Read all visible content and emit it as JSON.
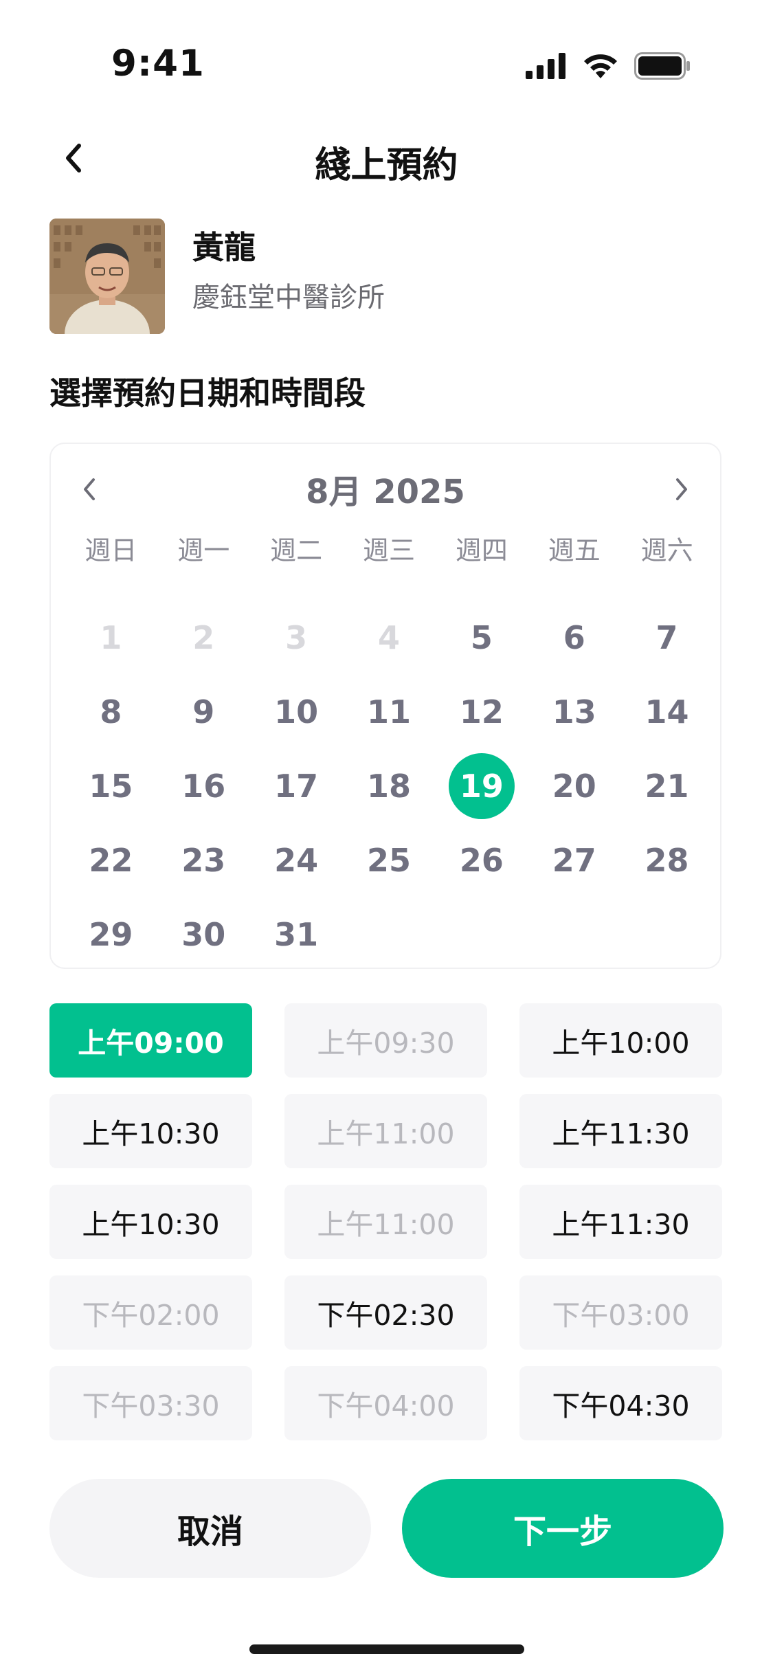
{
  "status_bar": {
    "time": "9:41"
  },
  "header": {
    "title": "綫上預約",
    "back_icon": "chevron-left-icon"
  },
  "doctor": {
    "name": "黃龍",
    "clinic": "慶鈺堂中醫診所"
  },
  "section_title": "選擇預約日期和時間段",
  "calendar": {
    "month_title": "8月 2025",
    "weekdays": [
      "週日",
      "週一",
      "週二",
      "週三",
      "週四",
      "週五",
      "週六"
    ],
    "days": [
      "1",
      "2",
      "3",
      "4",
      "5",
      "6",
      "7",
      "8",
      "9",
      "10",
      "11",
      "12",
      "13",
      "14",
      "15",
      "16",
      "17",
      "18",
      "19",
      "20",
      "21",
      "22",
      "23",
      "24",
      "25",
      "26",
      "27",
      "28",
      "29",
      "30",
      "31"
    ],
    "disabled_days": [
      "1",
      "2",
      "3",
      "4"
    ],
    "selected_day": "19"
  },
  "time_slots": [
    {
      "label": "上午09:00",
      "state": "selected"
    },
    {
      "label": "上午09:30",
      "state": "disabled"
    },
    {
      "label": "上午10:00",
      "state": "available"
    },
    {
      "label": "上午10:30",
      "state": "available"
    },
    {
      "label": "上午11:00",
      "state": "disabled"
    },
    {
      "label": "上午11:30",
      "state": "available"
    },
    {
      "label": "上午10:30",
      "state": "available"
    },
    {
      "label": "上午11:00",
      "state": "disabled"
    },
    {
      "label": "上午11:30",
      "state": "available"
    },
    {
      "label": "下午02:00",
      "state": "disabled"
    },
    {
      "label": "下午02:30",
      "state": "available"
    },
    {
      "label": "下午03:00",
      "state": "disabled"
    },
    {
      "label": "下午03:30",
      "state": "disabled"
    },
    {
      "label": "下午04:00",
      "state": "disabled"
    },
    {
      "label": "下午04:30",
      "state": "available"
    }
  ],
  "buttons": {
    "cancel": "取消",
    "next": "下一步"
  },
  "colors": {
    "accent": "#02c08f",
    "slot_bg": "#f6f6f8",
    "disabled_text": "#b8b8bd"
  }
}
